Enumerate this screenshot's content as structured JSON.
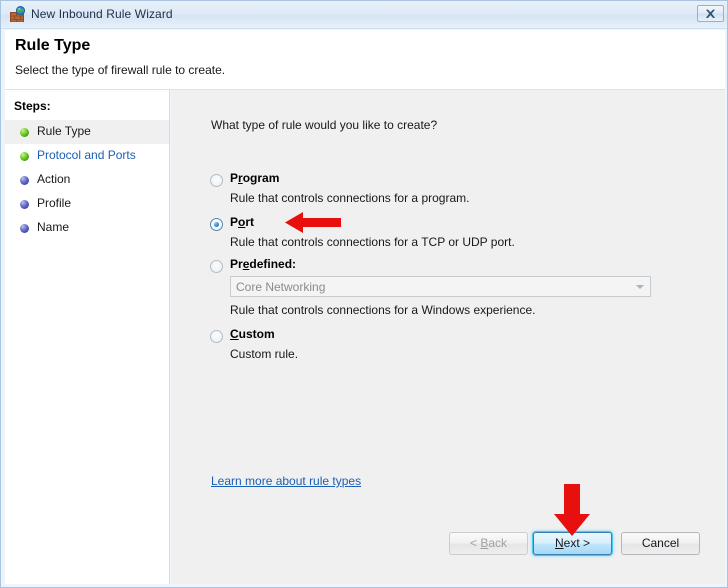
{
  "window": {
    "title": "New Inbound Rule Wizard",
    "icon": "firewall-globe-icon",
    "close_label": "Close"
  },
  "header": {
    "title": "Rule Type",
    "subtitle": "Select the type of firewall rule to create."
  },
  "sidebar": {
    "heading": "Steps:",
    "items": [
      {
        "label": "Rule Type",
        "bullet": "green",
        "state": "current"
      },
      {
        "label": "Protocol and Ports",
        "bullet": "green",
        "state": "link"
      },
      {
        "label": "Action",
        "bullet": "blue",
        "state": "pending"
      },
      {
        "label": "Profile",
        "bullet": "blue",
        "state": "pending"
      },
      {
        "label": "Name",
        "bullet": "blue",
        "state": "pending"
      }
    ]
  },
  "main": {
    "question": "What type of rule would you like to create?",
    "options": [
      {
        "label_before": "P",
        "label_accel": "r",
        "label_after": "ogram",
        "description": "Rule that controls connections for a program.",
        "selected": false
      },
      {
        "label_before": "P",
        "label_accel": "o",
        "label_after": "rt",
        "description": "Rule that controls connections for a TCP or UDP port.",
        "selected": true
      },
      {
        "label_before": "Pr",
        "label_accel": "e",
        "label_after": "defined:",
        "description": "Rule that controls connections for a Windows experience.",
        "selected": false
      },
      {
        "label_before": "",
        "label_accel": "C",
        "label_after": "ustom",
        "description": "Custom rule.",
        "selected": false
      }
    ],
    "predefined_combo": {
      "value": "Core Networking",
      "disabled": true
    },
    "learn_more_link": "Learn more about rule types"
  },
  "footer": {
    "back": {
      "before": "< ",
      "accel": "B",
      "after": "ack",
      "disabled": true
    },
    "next": {
      "before": "",
      "accel": "N",
      "after": "ext >",
      "default": true
    },
    "cancel": {
      "label": "Cancel"
    }
  },
  "annotations": {
    "arrow_port_color": "#e8100f",
    "arrow_next_color": "#e8100f"
  },
  "colors": {
    "accent_link": "#1a5fb4",
    "content_bg": "#f0f0f0",
    "sidebar_bg": "#ffffff",
    "default_button_border": "#3c7fb1"
  }
}
